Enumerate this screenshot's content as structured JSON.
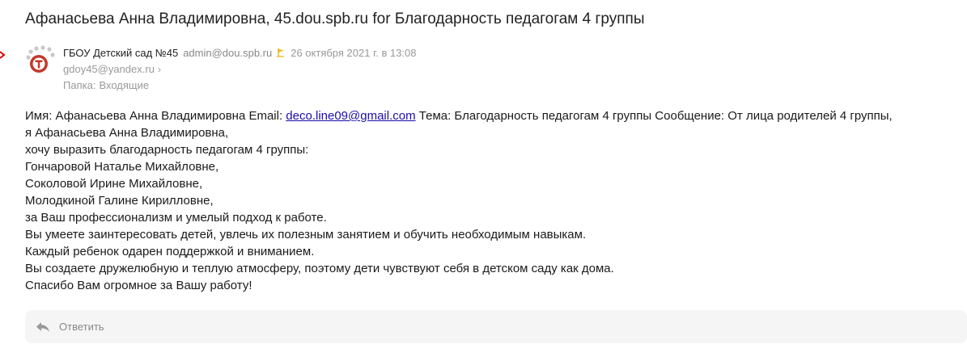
{
  "subject": "Афанасьева Анна Владимировна, 45.dou.spb.ru for Благодарность педагогам 4 группы",
  "sender": {
    "name": "ГБОУ Детский сад №45",
    "email": "admin@dou.spb.ru",
    "date": "26 октября 2021 г. в 13:08"
  },
  "recipient": "gdoy45@yandex.ru",
  "folder": {
    "label": "Папка:",
    "value": "Входящие"
  },
  "body": {
    "first_prefix": "Имя: Афанасьева Анна Владимировна Email: ",
    "link": "deco.line09@gmail.com",
    "first_suffix": " Тема: Благодарность педагогам 4 группы Сообщение: От лица родителей 4 группы,",
    "lines": [
      "я Афанасьева Анна Владимировна,",
      "хочу выразить благодарность педагогам 4 группы:",
      "Гончаровой Наталье Михайловне,",
      "Соколовой Ирине Михайловне,",
      "Молодкиной Галине Кирилловне,",
      "за Ваш профессионализм и умелый подход к работе.",
      "Вы умеете заинтересовать детей, увлечь их полезным занятием и обучить необходимым навыкам.",
      "Каждый ребенок одарен поддержкой и вниманием.",
      "Вы создаете дружелюбную и теплую атмосферу, поэтому дети чувствуют себя в детском саду как дома.",
      "Спасибо Вам огромное за Вашу работу!"
    ]
  },
  "reply": {
    "label": "Ответить"
  },
  "icons": {
    "avatar": "org-logo-avatar",
    "flag": "warning-flag-icon",
    "chevron": "chevron-right-icon",
    "reply": "reply-arrow-icon"
  },
  "colors": {
    "link": "#1a0dab",
    "muted": "#999999",
    "reply_bg": "#f5f5f5",
    "flag": "#f2c230",
    "avatar_red": "#c0392b"
  }
}
